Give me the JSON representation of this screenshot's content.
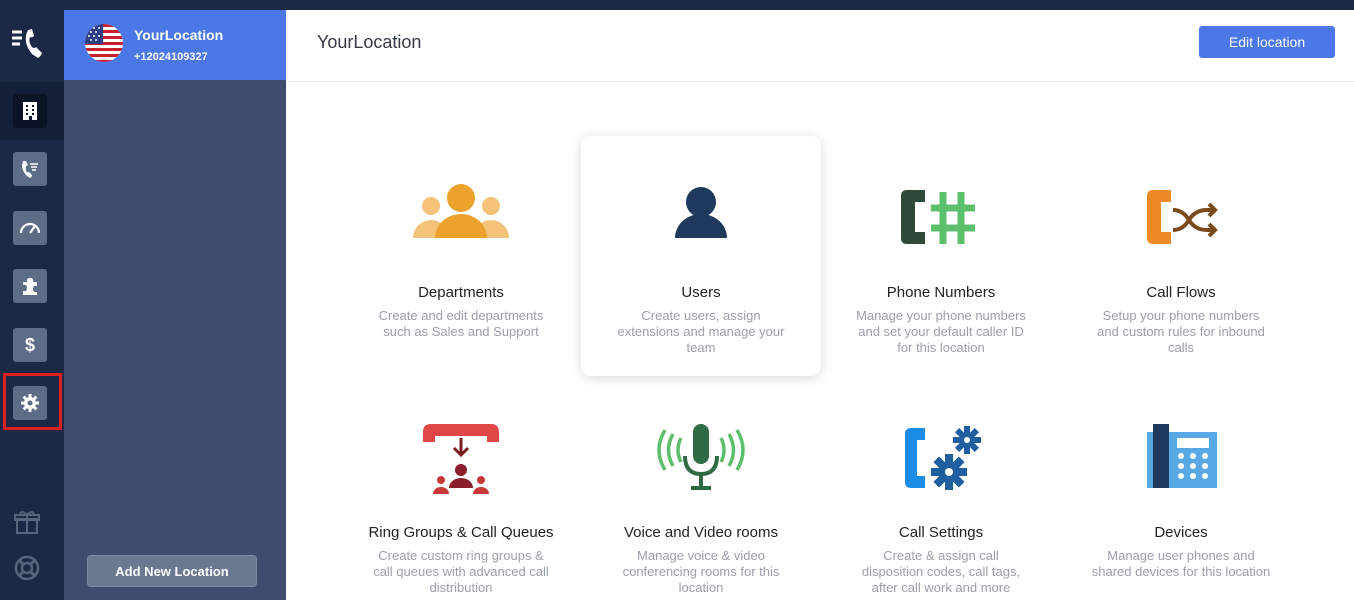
{
  "location": {
    "name": "YourLocation",
    "phone": "+12024109327"
  },
  "sidebar": {
    "add_location_label": "Add New Location",
    "rail_items": [
      "building-icon",
      "call-log-icon",
      "speedometer-icon",
      "puzzle-icon",
      "dollar-icon",
      "gear-icon"
    ]
  },
  "header": {
    "title": "YourLocation",
    "edit_label": "Edit location"
  },
  "tiles": [
    {
      "title": "Departments",
      "desc": "Create and edit departments such as Sales and Support"
    },
    {
      "title": "Users",
      "desc": "Create users, assign extensions and manage your team"
    },
    {
      "title": "Phone Numbers",
      "desc": "Manage your phone numbers and set your default caller ID for this location"
    },
    {
      "title": "Call Flows",
      "desc": "Setup your phone numbers and custom rules for inbound calls"
    },
    {
      "title": "Ring Groups & Call Queues",
      "desc": "Create custom ring groups & call queues with advanced call distribution"
    },
    {
      "title": "Voice and Video rooms",
      "desc": "Manage voice & video conferencing rooms for this location"
    },
    {
      "title": "Call Settings",
      "desc": "Create & assign call disposition codes, call tags, after call work and more"
    },
    {
      "title": "Devices",
      "desc": "Manage user phones and shared devices for this location"
    }
  ],
  "colors": {
    "accent": "#4b78e6",
    "rail": "#1b2946",
    "panel": "#3e4c6e",
    "highlight": "#e02020"
  }
}
